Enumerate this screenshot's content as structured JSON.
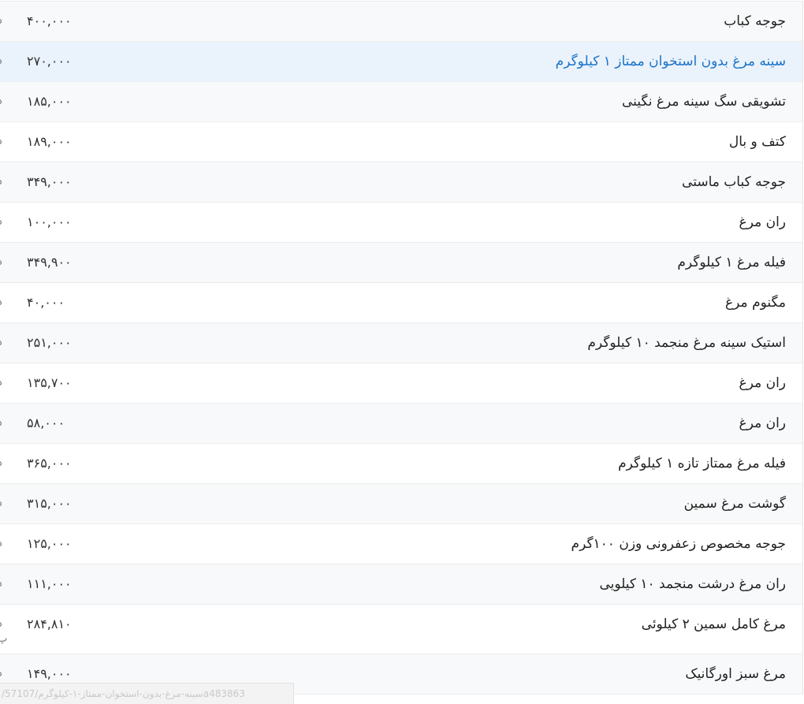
{
  "product_list": {
    "currency_unit": "د",
    "rows": [
      {
        "name": "جوجه کباب",
        "price": "۴۰۰,۰۰۰"
      },
      {
        "name": "سینه مرغ بدون استخوان ممتاز ۱ کیلوگرم",
        "price": "۲۷۰,۰۰۰"
      },
      {
        "name": "تشویقی سگ سینه مرغ نگینی",
        "price": "۱۸۵,۰۰۰"
      },
      {
        "name": "کتف و بال",
        "price": "۱۸۹,۰۰۰"
      },
      {
        "name": "جوجه کباب ماستی",
        "price": "۳۴۹,۰۰۰"
      },
      {
        "name": "ران مرغ",
        "price": "۱۰۰,۰۰۰"
      },
      {
        "name": "فیله مرغ ۱ کیلوگرم",
        "price": "۳۴۹,۹۰۰"
      },
      {
        "name": "مگنوم مرغ",
        "price": "۴۰,۰۰۰"
      },
      {
        "name": "استیک سینه مرغ منجمد ۱۰ کیلوگرم",
        "price": "۲۵۱,۰۰۰"
      },
      {
        "name": "ران مرغ",
        "price": "۱۳۵,۷۰۰"
      },
      {
        "name": "ران مرغ",
        "price": "۵۸,۰۰۰"
      },
      {
        "name": "فیله مرغ ممتاز تازه ۱ کیلوگرم",
        "price": "۳۶۵,۰۰۰"
      },
      {
        "name": "گوشت مرغ سمین",
        "price": "۳۱۵,۰۰۰"
      },
      {
        "name": "جوجه مخصوص زعفرونی وزن ۱۰۰گرم",
        "price": "۱۲۵,۰۰۰"
      },
      {
        "name": "ران مرغ درشت منجمد ۱۰ کیلویی",
        "price": "۱۱۱,۰۰۰"
      },
      {
        "name": "مرغ کامل سمین ۲ کیلوئی",
        "price": "۲۸۴,۸۱۰",
        "unit_extra": "پ"
      },
      {
        "name": "مرغ سبز اورگانیک",
        "price": "۱۴۹,۰۰۰"
      }
    ]
  },
  "status_bar": {
    "url": "/سینه-مرغ-بدون-استخوان-ممتاز-۱-کیلوگرم/57107a483863"
  }
}
